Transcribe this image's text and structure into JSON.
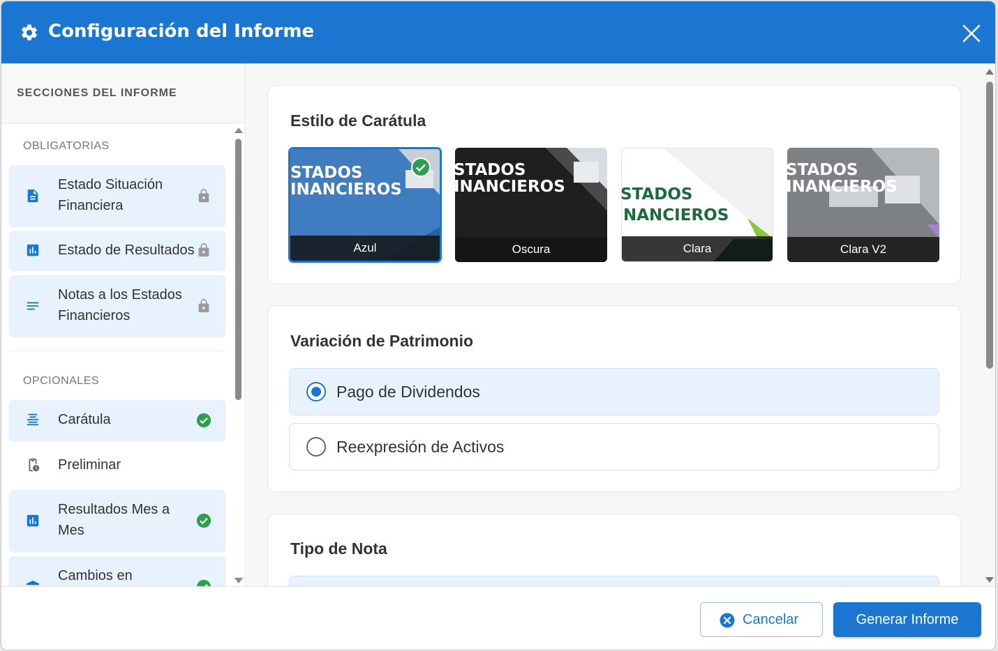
{
  "header": {
    "title": "Configuración del Informe",
    "icon": "gear-icon",
    "close_icon": "close-icon"
  },
  "sidebar": {
    "title": "SECCIONES DEL INFORME",
    "mandatory_label": "OBLIGATORIAS",
    "mandatory": [
      {
        "label": "Estado Situación Financiera",
        "icon": "document-icon",
        "status": "lock-icon"
      },
      {
        "label": "Estado de Resultados",
        "icon": "bar-chart-icon",
        "status": "lock-icon"
      },
      {
        "label": "Notas a los Estados Financieros",
        "icon": "notes-lines-icon",
        "status": "lock-icon"
      }
    ],
    "optional_label": "OPCIONALES",
    "optional": [
      {
        "label": "Carátula",
        "icon": "cover-icon",
        "status": "check-circle-icon",
        "selected": true
      },
      {
        "label": "Preliminar",
        "icon": "clipboard-clock-icon",
        "selected": false
      },
      {
        "label": "Resultados Mes a Mes",
        "icon": "bar-chart-icon",
        "status": "check-circle-icon",
        "selected": true
      },
      {
        "label": "Cambios en",
        "icon": "bank-icon",
        "status": "check-circle-icon",
        "selected": true
      }
    ]
  },
  "cover_style": {
    "title": "Estilo de Carátula",
    "cover_title_line1": "STADOS",
    "cover_title_line2": "INANCIEROS",
    "cover_title_line2_alt": "NANCIEROS",
    "options": [
      {
        "name": "Azul",
        "selected": true,
        "color": "#3f7cc0"
      },
      {
        "name": "Oscura",
        "selected": false,
        "color": "#1f1f1f"
      },
      {
        "name": "Clara",
        "selected": false,
        "color": "#f3f3f3"
      },
      {
        "name": "Clara V2",
        "selected": false,
        "color": "#8a8a8a"
      }
    ]
  },
  "equity": {
    "title": "Variación de Patrimonio",
    "options": [
      {
        "label": "Pago de Dividendos",
        "selected": true
      },
      {
        "label": "Reexpresión de Activos",
        "selected": false
      }
    ]
  },
  "note_type": {
    "title": "Tipo de Nota"
  },
  "footer": {
    "cancel_label": "Cancelar",
    "generate_label": "Generar Informe"
  },
  "colors": {
    "primary": "#1b76d2",
    "success": "#2e9e4f",
    "selected_bg": "#e8f2fc"
  }
}
